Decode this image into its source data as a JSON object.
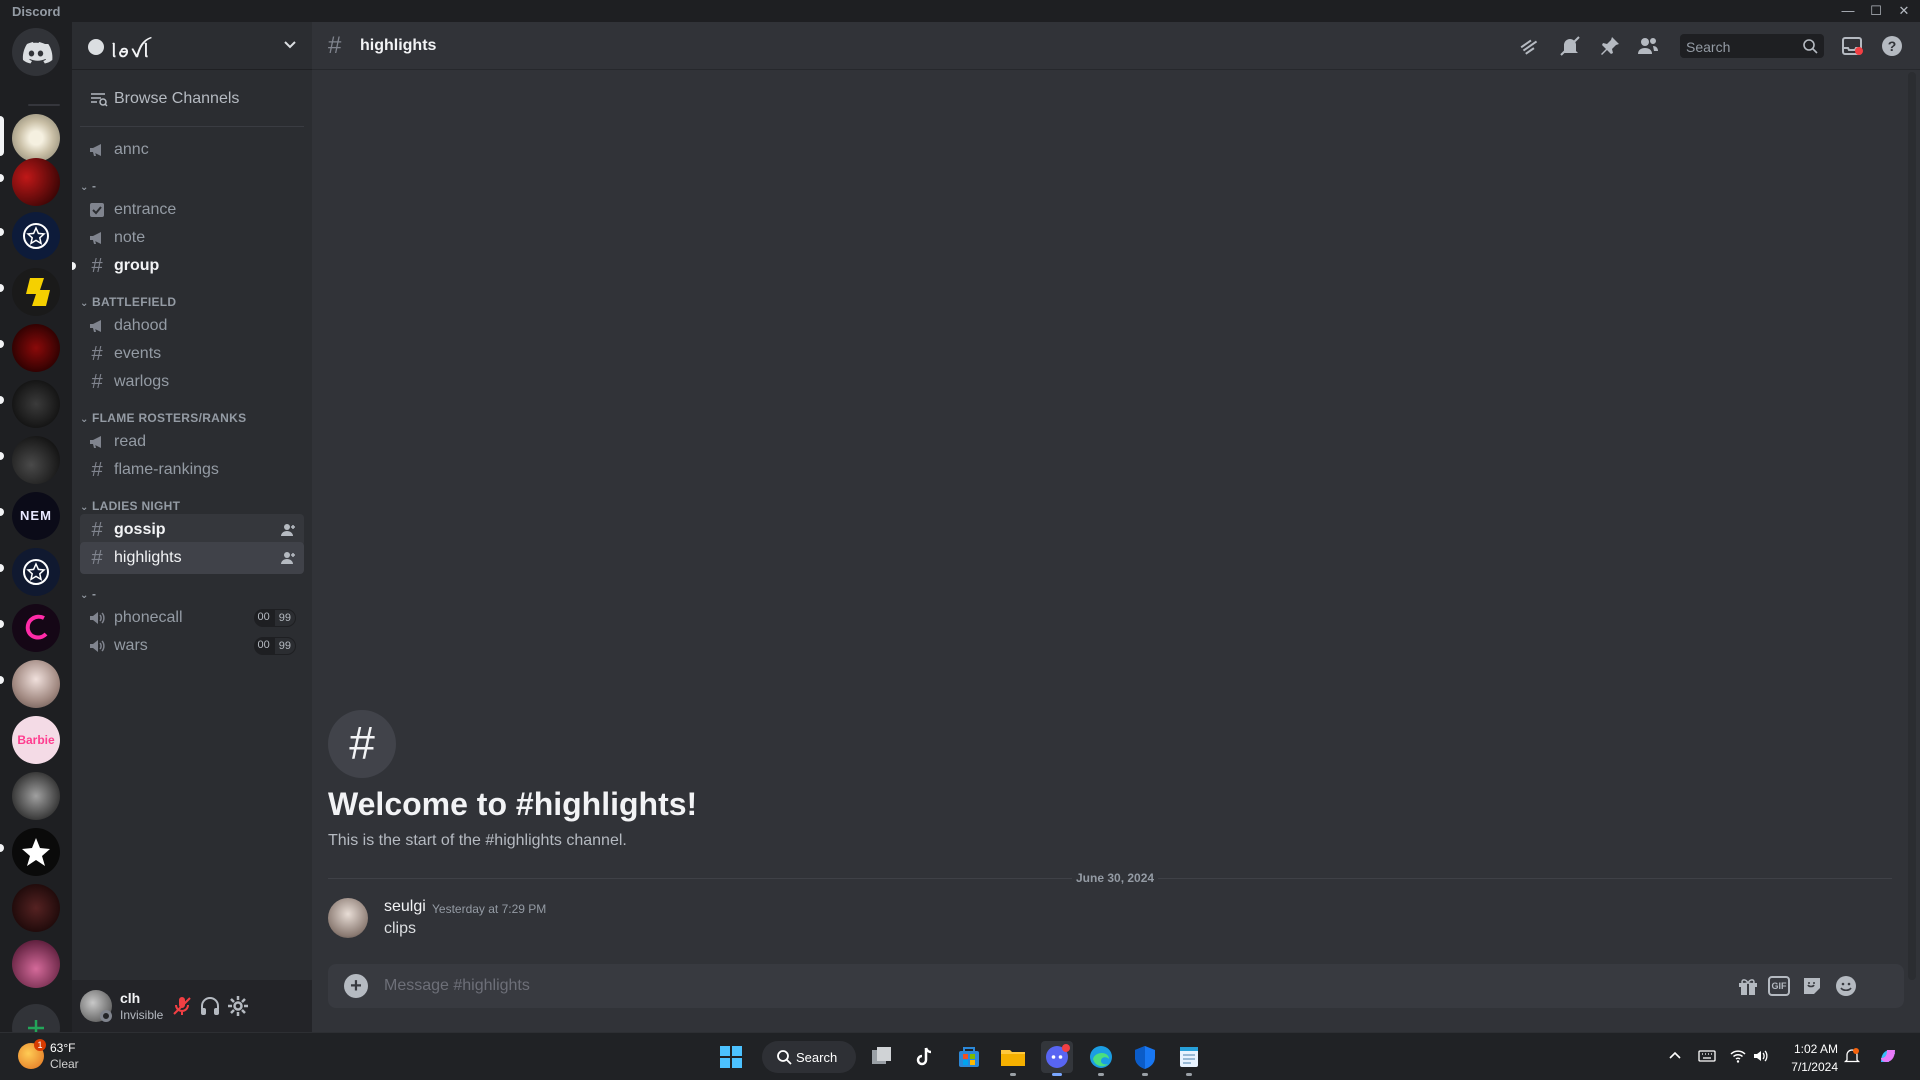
{
  "window": {
    "title": "Discord",
    "minimize": "—",
    "maximize": "☐",
    "close": "✕"
  },
  "guild": {
    "name": "ᥣꪮꪜᥣ"
  },
  "sidebar": {
    "browse_label": "Browse Channels",
    "top_channels": [
      {
        "name": "annc",
        "type": "announcement"
      }
    ],
    "categories": [
      {
        "name": "-",
        "channels": [
          {
            "name": "entrance",
            "type": "rules"
          },
          {
            "name": "note",
            "type": "announcement"
          },
          {
            "name": "group",
            "type": "text",
            "unread": true
          }
        ]
      },
      {
        "name": "BATTLEFIELD",
        "channels": [
          {
            "name": "dahood",
            "type": "announcement"
          },
          {
            "name": "events",
            "type": "text"
          },
          {
            "name": "warlogs",
            "type": "text"
          }
        ]
      },
      {
        "name": "FLAME ROSTERS/RANKS",
        "channels": [
          {
            "name": "read",
            "type": "announcement"
          },
          {
            "name": "flame-rankings",
            "type": "text"
          }
        ]
      },
      {
        "name": "LADIES NIGHT",
        "channels": [
          {
            "name": "gossip",
            "type": "text",
            "unread": true
          },
          {
            "name": "highlights",
            "type": "text",
            "selected": true
          }
        ]
      },
      {
        "name": "-",
        "channels": [
          {
            "name": "phonecall",
            "type": "voice",
            "count": "00",
            "limit": "99"
          },
          {
            "name": "wars",
            "type": "voice",
            "count": "00",
            "limit": "99"
          }
        ]
      }
    ]
  },
  "user": {
    "name": "clh",
    "status": "Invisible"
  },
  "channel": {
    "name": "highlights",
    "search_placeholder": "Search",
    "welcome_title": "Welcome to #highlights!",
    "welcome_sub": "This is the start of the #highlights channel.",
    "date_divider": "June 30, 2024",
    "message": {
      "author": "seulgi",
      "timestamp": "Yesterday at 7:29 PM",
      "content": "clips"
    },
    "composer_placeholder": "Message #highlights",
    "gif_label": "GIF"
  },
  "taskbar": {
    "weather_temp": "63°F",
    "weather_cond": "Clear",
    "weather_badge": "1",
    "search_label": "Search",
    "time": "1:02 AM",
    "date": "7/1/2024"
  },
  "colors": {
    "accent": "#5865f2",
    "green_add": "#23a559",
    "mute_red": "#f23f43"
  }
}
